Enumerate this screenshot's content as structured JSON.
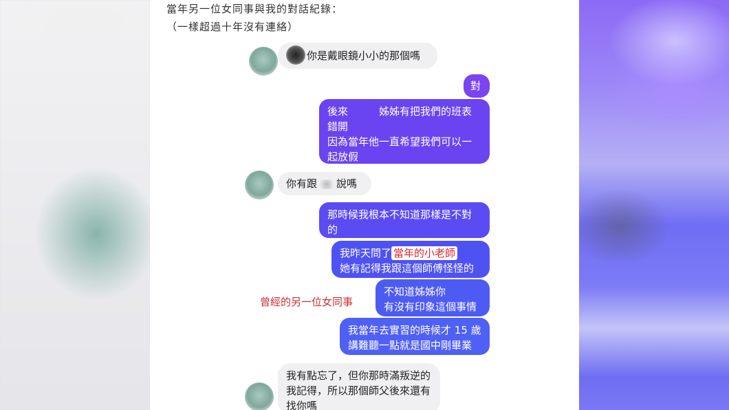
{
  "caption": {
    "line1": "當年另一位女同事與我的對話紀錄：",
    "line2": "（一樣超過十年沒有連絡）"
  },
  "side_label": "曾經的另一位女同事",
  "messages": [
    {
      "from": "other",
      "text": "你是戴眼鏡小小的那個嗎"
    },
    {
      "from": "me",
      "text": "對"
    },
    {
      "from": "me",
      "text": "後來　　　姊姊有把我們的班表\n錯開\n因為當年他一直希望我們可以一\n起放假"
    },
    {
      "from": "other",
      "text_before": "你有跟",
      "text_after": "說嗎"
    },
    {
      "from": "me",
      "text": "那時候我根本不知道那樣是不對\n的"
    },
    {
      "from": "me",
      "text_before": "我昨天問了",
      "highlight": "當年的小老師",
      "text_line2": "她有記得我跟這個師傅怪怪的"
    },
    {
      "from": "me",
      "text": "不知道姊姊你\n有沒有印象這個事情"
    },
    {
      "from": "me",
      "text": "我當年去實習的時候才 15 歲\n講難聽一點就是國中剛畢業"
    },
    {
      "from": "other",
      "text": "我有點忘了，但你那時滿叛逆的\n我記得，所以那個師父後來還有\n找你嗎"
    }
  ]
}
